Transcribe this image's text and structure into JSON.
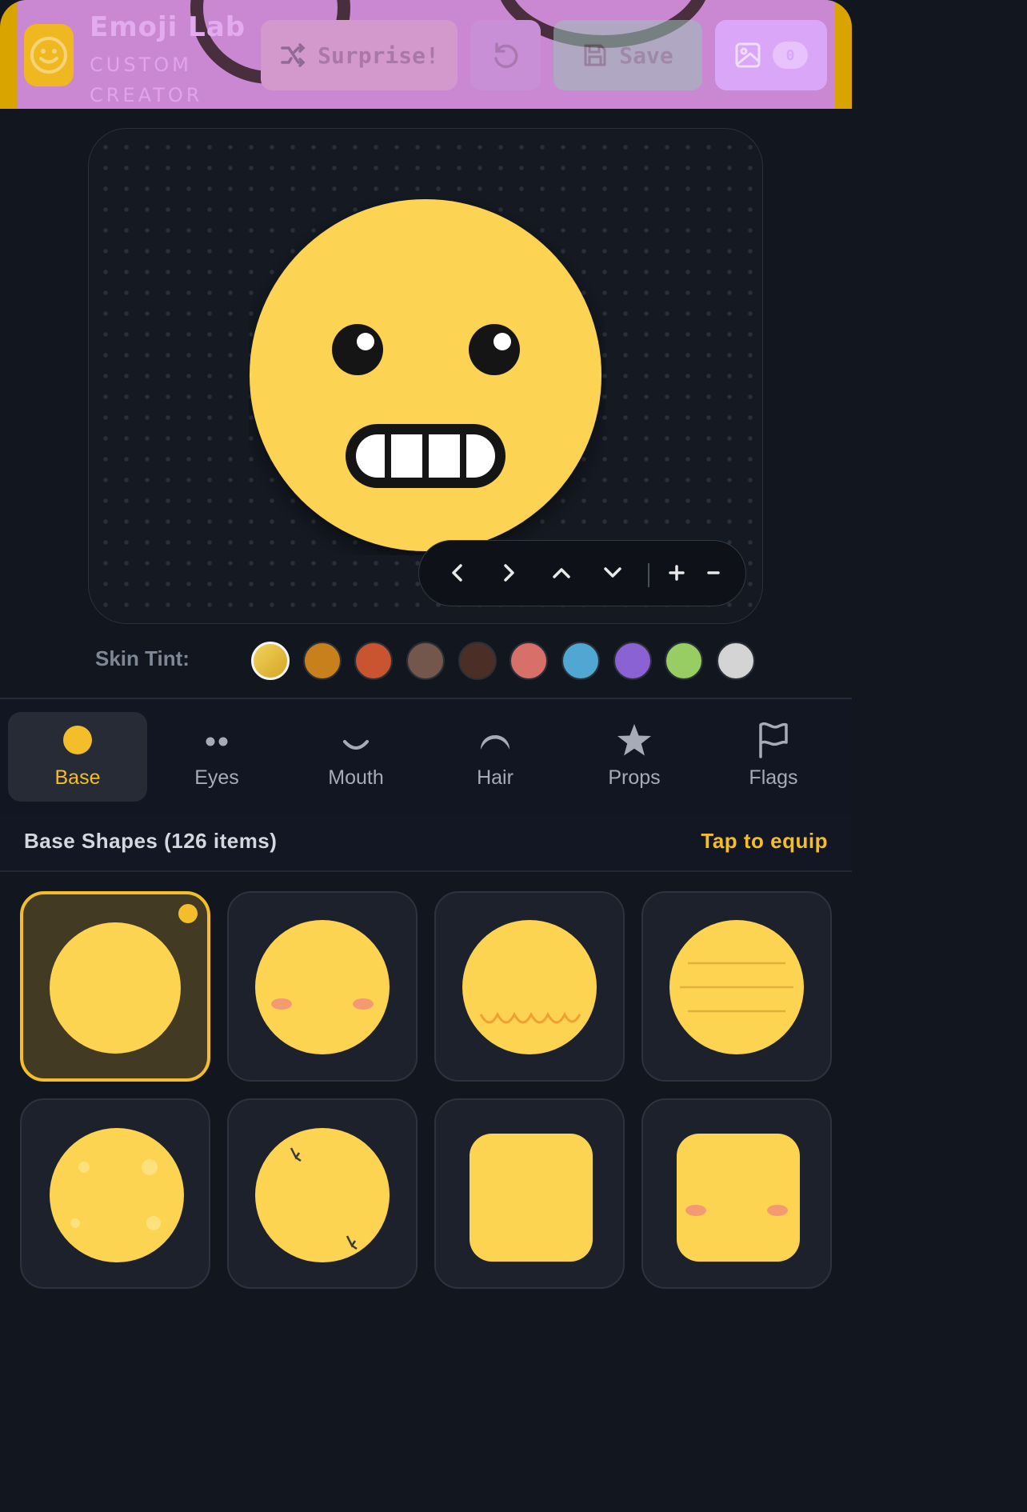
{
  "header": {
    "title": "Emoji Lab",
    "subtitle": "CUSTOM CREATOR",
    "surprise_label": "Surprise!",
    "save_label": "Save",
    "gallery_count": "0"
  },
  "canvas": {
    "controls": [
      "<",
      ">",
      "^",
      "v",
      "+",
      "-"
    ]
  },
  "skin_tint": {
    "label": "Skin Tint:",
    "swatches": [
      "#e6be37",
      "#c8801c",
      "#c95530",
      "#73564c",
      "#4b2f27",
      "#d8706a",
      "#4fa7d2",
      "#8b62d3",
      "#98cd63",
      "#d4d4d4"
    ],
    "selected_index": 0
  },
  "tabs": [
    {
      "label": "Base",
      "icon": "circle-icon",
      "active": true
    },
    {
      "label": "Eyes",
      "icon": "eyes-icon"
    },
    {
      "label": "Mouth",
      "icon": "smile-icon"
    },
    {
      "label": "Hair",
      "icon": "hair-icon"
    },
    {
      "label": "Props",
      "icon": "star-icon"
    },
    {
      "label": "Flags",
      "icon": "flag-icon"
    }
  ],
  "section": {
    "title": "Base Shapes (126 items)",
    "hint": "Tap to equip"
  },
  "colors": {
    "accent": "#f4bd2a",
    "face": "#fdd352",
    "header_bg": "#c887d8",
    "bg": "#12161e"
  }
}
